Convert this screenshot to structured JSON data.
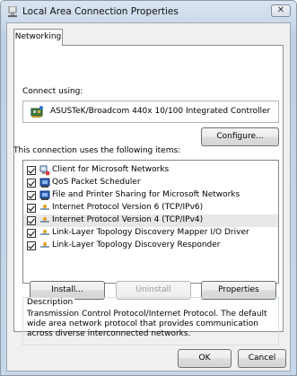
{
  "window": {
    "title": "Local Area Connection Properties",
    "close_label": "✕"
  },
  "tabs": [
    {
      "label": "Networking"
    }
  ],
  "connect_using": {
    "label": "Connect using:",
    "adapter": "ASUSTeK/Broadcom 440x 10/100 Integrated Controller",
    "configure_label": "Configure..."
  },
  "items_section": {
    "label": "This connection uses the following items:",
    "items": [
      {
        "label": "Client for Microsoft Networks",
        "checked": true,
        "icon": "network-client-icon"
      },
      {
        "label": "QoS Packet Scheduler",
        "checked": true,
        "icon": "service-icon"
      },
      {
        "label": "File and Printer Sharing for Microsoft Networks",
        "checked": true,
        "icon": "service-icon"
      },
      {
        "label": "Internet Protocol Version 6 (TCP/IPv6)",
        "checked": true,
        "icon": "protocol-icon"
      },
      {
        "label": "Internet Protocol Version 4 (TCP/IPv4)",
        "checked": true,
        "icon": "protocol-icon",
        "selected": true
      },
      {
        "label": "Link-Layer Topology Discovery Mapper I/O Driver",
        "checked": true,
        "icon": "protocol-icon"
      },
      {
        "label": "Link-Layer Topology Discovery Responder",
        "checked": true,
        "icon": "protocol-icon"
      }
    ]
  },
  "actions": {
    "install": "Install...",
    "uninstall": "Uninstall",
    "properties": "Properties"
  },
  "description": {
    "title": "Description",
    "text": "Transmission Control Protocol/Internet Protocol. The default wide area network protocol that provides communication across diverse interconnected networks."
  },
  "footer": {
    "ok": "OK",
    "cancel": "Cancel"
  }
}
